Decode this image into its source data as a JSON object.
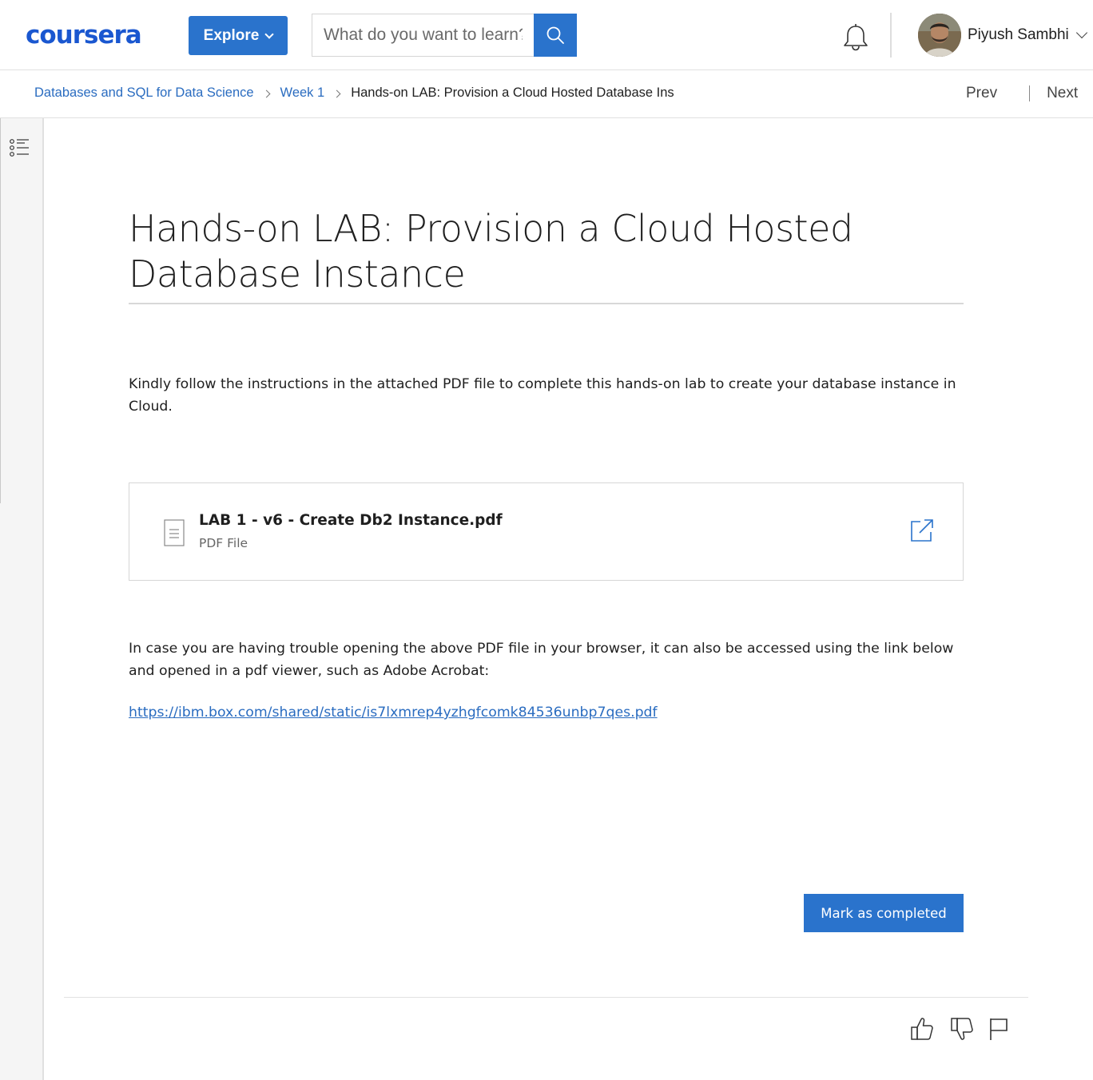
{
  "header": {
    "logo_text": "coursera",
    "explore_label": "Explore",
    "search_placeholder": "What do you want to learn?",
    "search_icon": "search-icon",
    "notification_icon": "bell-icon",
    "user_name": "Piyush Sambhi",
    "brand_color": "#2a73cc"
  },
  "breadcrumb": {
    "items": [
      {
        "label": "Databases and SQL for Data Science"
      },
      {
        "label": "Week 1"
      }
    ],
    "current": "Hands-on LAB: Provision a Cloud Hosted Database Ins",
    "prev_label": "Prev",
    "next_label": "Next"
  },
  "sidebar": {
    "toc_icon": "list-icon"
  },
  "main": {
    "title": "Hands-on LAB: Provision a Cloud Hosted Database Instance",
    "intro": "Kindly follow the instructions in the attached PDF file to complete this hands-on lab to create your database instance in Cloud.",
    "file": {
      "name": "LAB 1 - v6 - Create Db2 Instance.pdf",
      "type": "PDF File",
      "icon": "document-icon",
      "open_icon": "external-link-icon"
    },
    "trouble_text": "In case you are having trouble opening the above PDF file in your browser, it can also be accessed using the link below and opened in a pdf viewer, such as Adobe Acrobat:",
    "pdf_link": "https://ibm.box.com/shared/static/is7lxmrep4yzhgfcomk84536unbp7qes.pdf",
    "mark_completed_label": "Mark as completed"
  },
  "feedback": {
    "icons": [
      "thumbs-up-icon",
      "thumbs-down-icon",
      "flag-icon"
    ]
  }
}
